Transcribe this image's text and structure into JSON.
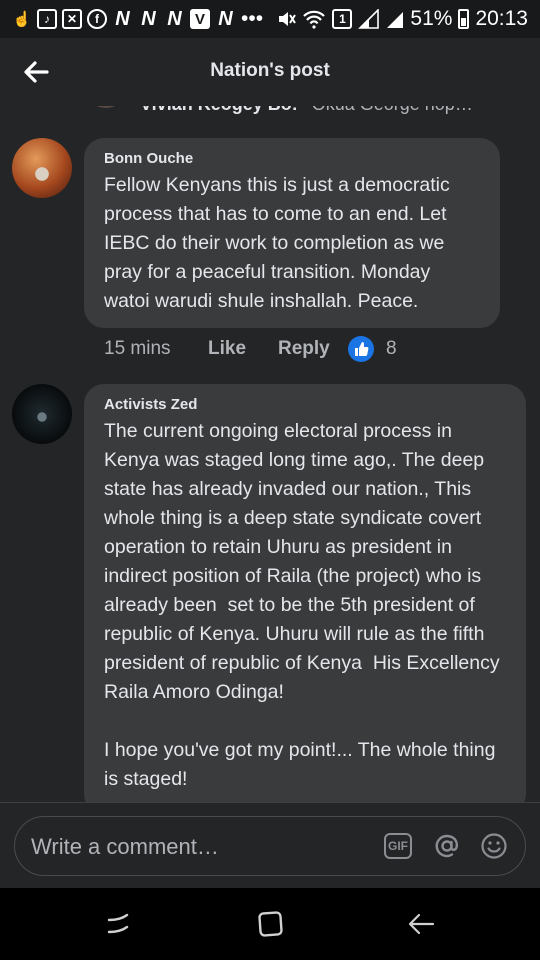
{
  "status_bar": {
    "battery": "51%",
    "time": "20:13",
    "signal_badge": "1",
    "overflow": "•••"
  },
  "header": {
    "title": "Nation's post"
  },
  "previous_comment": {
    "author": "Vivian Keogey Bo!",
    "preview": "Okua George hop…"
  },
  "comments": [
    {
      "author": "Bonn Ouche",
      "text": "Fellow Kenyans this is just a democratic process that has to come to an end. Let IEBC do their work to completion as we pray for a peaceful transition. Monday watoi warudi shule inshallah. Peace.",
      "time": "15 mins",
      "like_label": "Like",
      "reply_label": "Reply",
      "reaction_count": "8"
    },
    {
      "author": "Activists Zed",
      "text": "The current ongoing electoral process in Kenya was staged long time ago,. The deep state has already invaded our nation., This whole thing is a deep state syndicate covert operation to retain Uhuru as president in indirect position of Raila (the project) who is already been  set to be the 5th president of republic of Kenya. Uhuru will rule as the fifth president of republic of Kenya  His Excellency Raila Amoro Odinga!\n\nI hope you've got my point!... The whole thing is staged!"
    }
  ],
  "composer": {
    "placeholder": "Write a comment…",
    "gif_label": "GIF"
  },
  "colors": {
    "background": "#18191a",
    "surface": "#242526",
    "bubble": "#3a3b3c",
    "accent": "#1b74e4"
  }
}
